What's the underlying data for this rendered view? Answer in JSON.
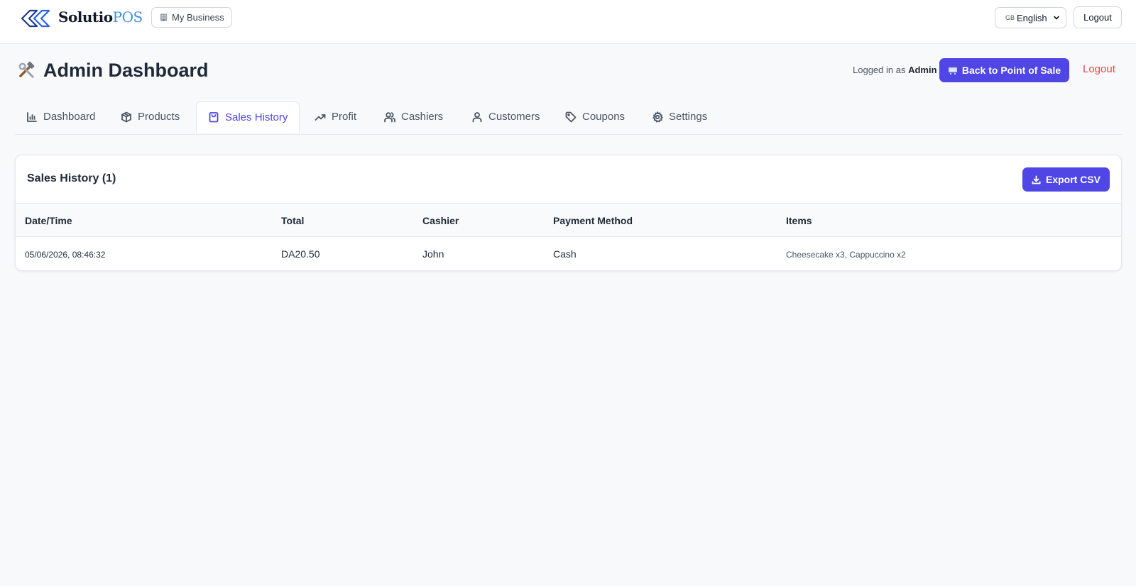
{
  "app": {
    "logo_main": "Solutio",
    "logo_accent": "POS",
    "business_label": "My Business",
    "language": {
      "flag": "GB",
      "selected": "English"
    },
    "logout_label": "Logout"
  },
  "header": {
    "title": "Admin Dashboard",
    "logged_in_prefix": "Logged in as",
    "logged_in_user": "Admin",
    "back_button_label": "Back to Point of Sale",
    "logout_label": "Logout"
  },
  "tabs": [
    {
      "label": "Dashboard",
      "icon": "bar-chart-icon"
    },
    {
      "label": "Products",
      "icon": "box-icon"
    },
    {
      "label": "Sales History",
      "icon": "shopping-bag-icon",
      "active": true
    },
    {
      "label": "Profit",
      "icon": "trending-up-icon"
    },
    {
      "label": "Cashiers",
      "icon": "users-icon"
    },
    {
      "label": "Customers",
      "icon": "user-icon"
    },
    {
      "label": "Coupons",
      "icon": "tag-icon"
    },
    {
      "label": "Settings",
      "icon": "gear-icon"
    }
  ],
  "sales": {
    "title": "Sales History (1)",
    "export_label": "Export CSV",
    "columns": [
      "Date/Time",
      "Total",
      "Cashier",
      "Payment Method",
      "Items"
    ],
    "rows": [
      {
        "datetime": "05/06/2026, 08:46:32",
        "total": "DA20.50",
        "cashier": "John",
        "payment_method": "Cash",
        "items": "Cheesecake x3, Cappuccino x2"
      }
    ]
  },
  "colors": {
    "accent": "#4f46e5",
    "logout_red": "#ef4444",
    "logo_blue": "#3b8fe0"
  }
}
